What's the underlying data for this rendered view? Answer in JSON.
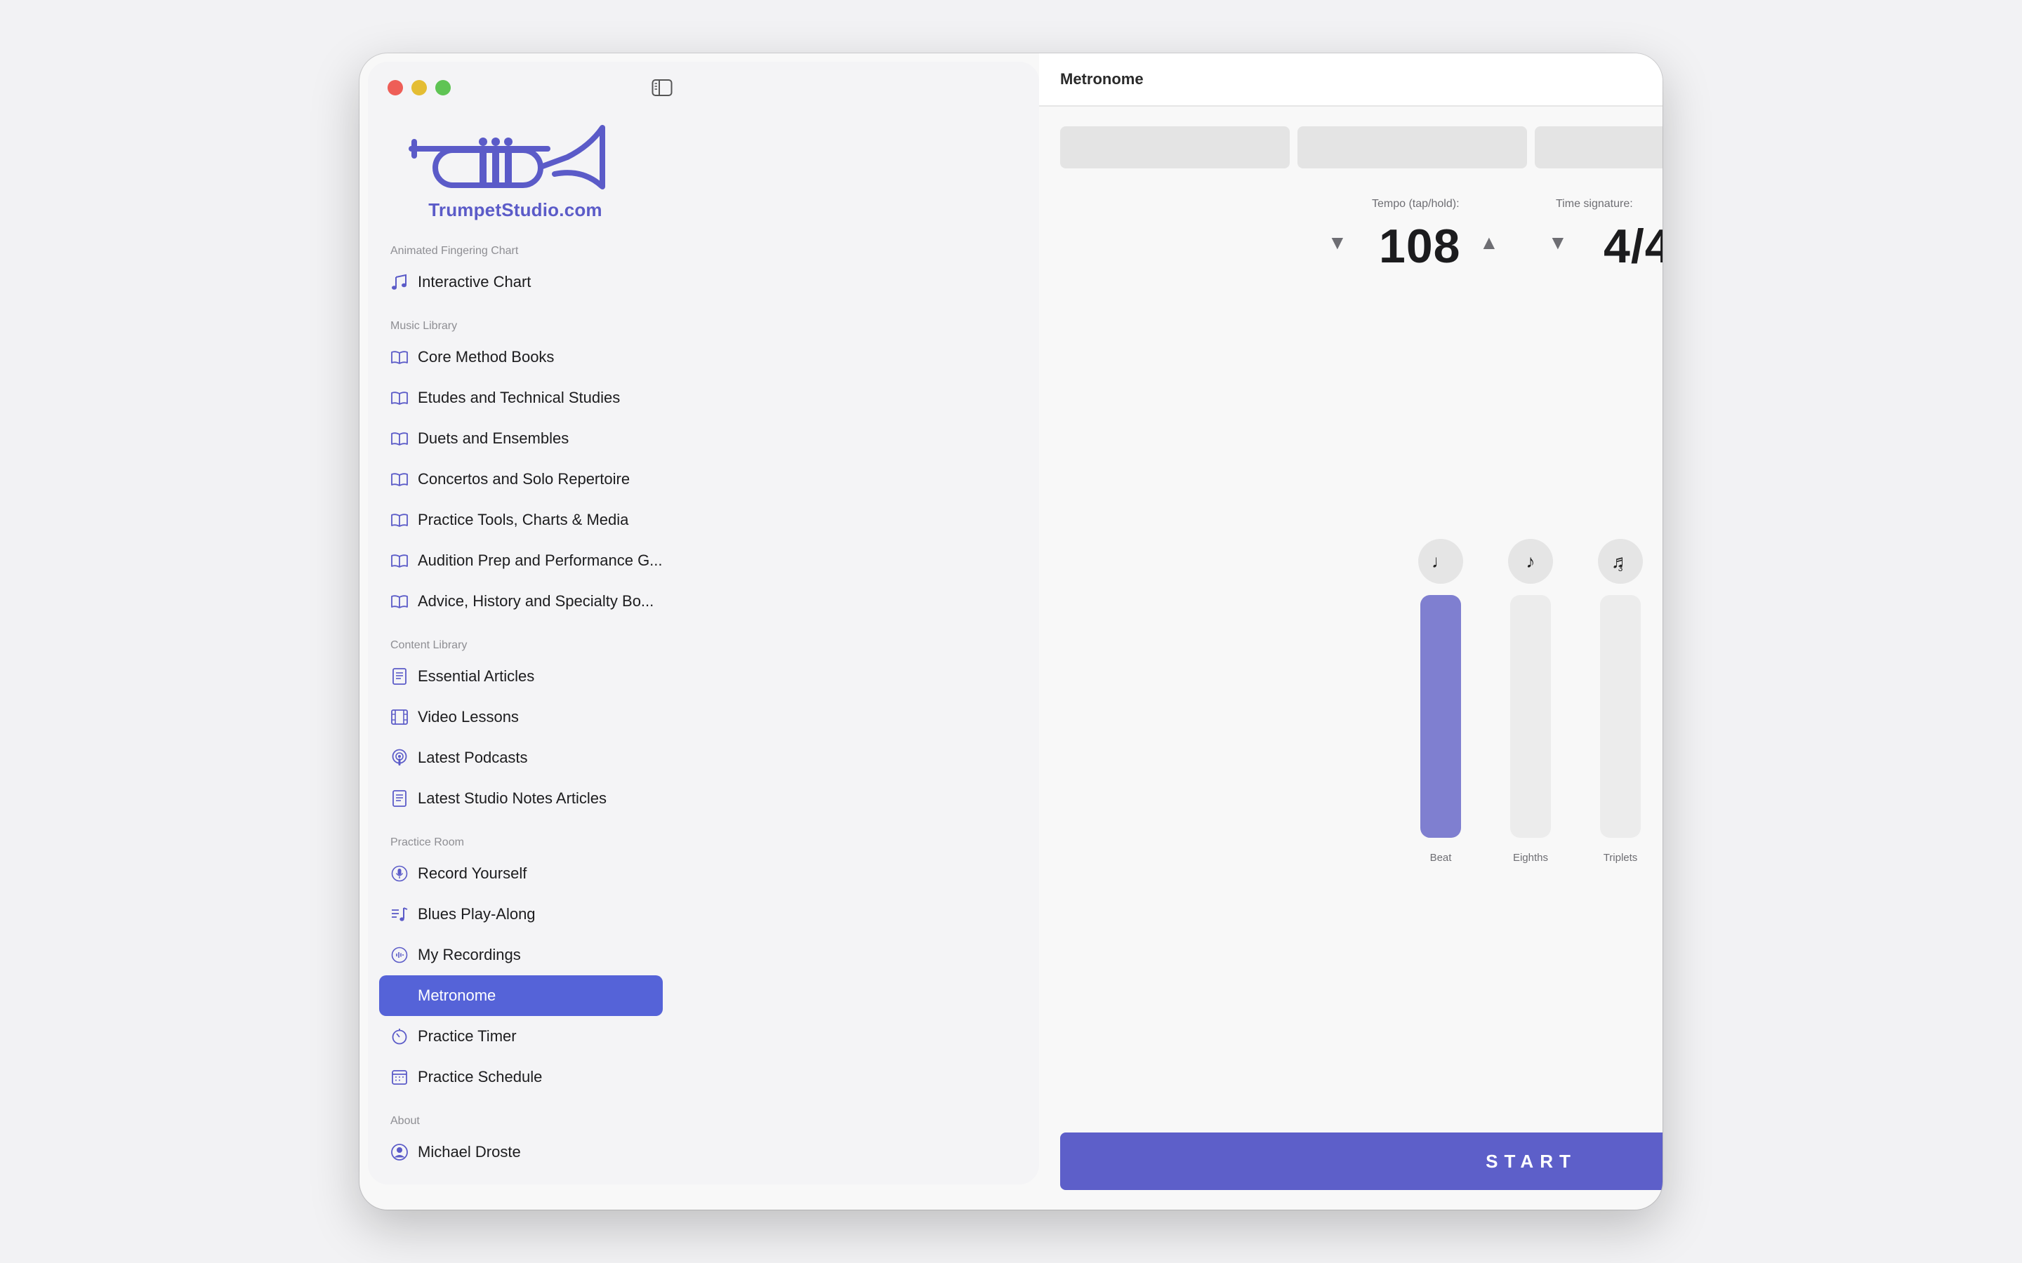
{
  "window": {
    "title": "Metronome"
  },
  "logo": {
    "text": "TrumpetStudio.com",
    "icon": "trumpet-logo"
  },
  "sidebar": {
    "sections": [
      {
        "heading": "Animated Fingering Chart",
        "items": [
          {
            "label": "Interactive Chart",
            "icon": "music-note-icon"
          }
        ]
      },
      {
        "heading": "Music Library",
        "items": [
          {
            "label": "Core Method Books",
            "icon": "book-icon"
          },
          {
            "label": "Etudes and Technical Studies",
            "icon": "book-icon"
          },
          {
            "label": "Duets and Ensembles",
            "icon": "book-icon"
          },
          {
            "label": "Concertos and Solo Repertoire",
            "icon": "book-icon"
          },
          {
            "label": "Practice Tools, Charts & Media",
            "icon": "book-icon"
          },
          {
            "label": "Audition Prep and Performance G...",
            "icon": "book-icon"
          },
          {
            "label": "Advice, History and Specialty Bo...",
            "icon": "book-icon"
          }
        ]
      },
      {
        "heading": "Content Library",
        "items": [
          {
            "label": "Essential Articles",
            "icon": "document-icon"
          },
          {
            "label": "Video Lessons",
            "icon": "film-icon"
          },
          {
            "label": "Latest Podcasts",
            "icon": "podcast-icon"
          },
          {
            "label": "Latest Studio Notes Articles",
            "icon": "document-icon"
          }
        ]
      },
      {
        "heading": "Practice Room",
        "items": [
          {
            "label": "Record Yourself",
            "icon": "microphone-icon"
          },
          {
            "label": "Blues Play-Along",
            "icon": "music-list-icon"
          },
          {
            "label": "My Recordings",
            "icon": "waveform-icon"
          },
          {
            "label": "Metronome",
            "icon": "metronome-icon",
            "selected": true
          },
          {
            "label": "Practice Timer",
            "icon": "timer-icon"
          },
          {
            "label": "Practice Schedule",
            "icon": "calendar-icon"
          }
        ]
      },
      {
        "heading": "About",
        "items": [
          {
            "label": "Michael Droste",
            "icon": "person-icon"
          }
        ]
      }
    ]
  },
  "metronome": {
    "tempo_label": "Tempo (tap/hold):",
    "tempo": "108",
    "time_sig_label": "Time signature:",
    "time_signature": "4/4",
    "decrease_glyph": "▼",
    "increase_glyph": "▲",
    "subdivisions": [
      {
        "label": "Beat",
        "glyph": "♩",
        "sub": "",
        "level": 1.0
      },
      {
        "label": "Eighths",
        "glyph": "♪",
        "sub": "",
        "level": 0.0
      },
      {
        "label": "Triplets",
        "glyph": "♬",
        "sub": "3",
        "level": 0.0
      }
    ],
    "start_label": "START"
  },
  "colors": {
    "accent": "#5b5bc8",
    "selected": "#5563d8",
    "start": "#5d5fc9",
    "beat_on": "#7f7fd0"
  }
}
